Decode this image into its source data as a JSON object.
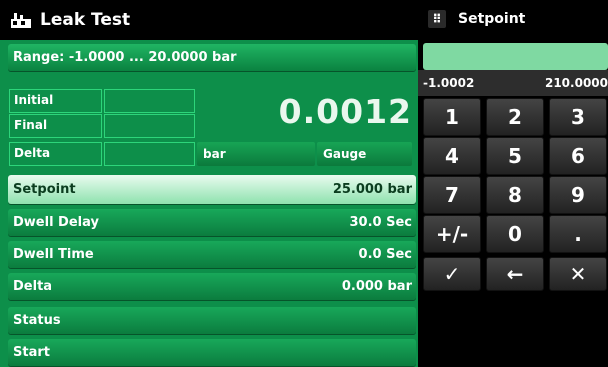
{
  "title": "Leak Test",
  "range": "Range: -1.0000 ... 20.0000 bar",
  "measure": {
    "initial_label": "Initial",
    "final_label": "Final",
    "delta_label": "Delta",
    "reading": "0.0012",
    "unit": "bar",
    "mode": "Gauge"
  },
  "rows": {
    "setpoint": {
      "label": "Setpoint",
      "value": "25.000 bar"
    },
    "dwell_delay": {
      "label": "Dwell Delay",
      "value": "30.0 Sec"
    },
    "dwell_time": {
      "label": "Dwell Time",
      "value": "0.0 Sec"
    },
    "delta": {
      "label": "Delta",
      "value": "0.000 bar"
    },
    "status": {
      "label": "Status",
      "value": ""
    },
    "start": {
      "label": "Start",
      "value": ""
    }
  },
  "keypad": {
    "title": "Setpoint",
    "min": "-1.0002",
    "max": "210.0000",
    "keys": [
      "1",
      "2",
      "3",
      "4",
      "5",
      "6",
      "7",
      "8",
      "9",
      "+/-",
      "0",
      ".",
      "✓",
      "←",
      "✕"
    ]
  },
  "colors": {
    "panel_green": "#0d8f4a",
    "highlight": "#8ee2ae",
    "entry": "#7fd9a2"
  }
}
